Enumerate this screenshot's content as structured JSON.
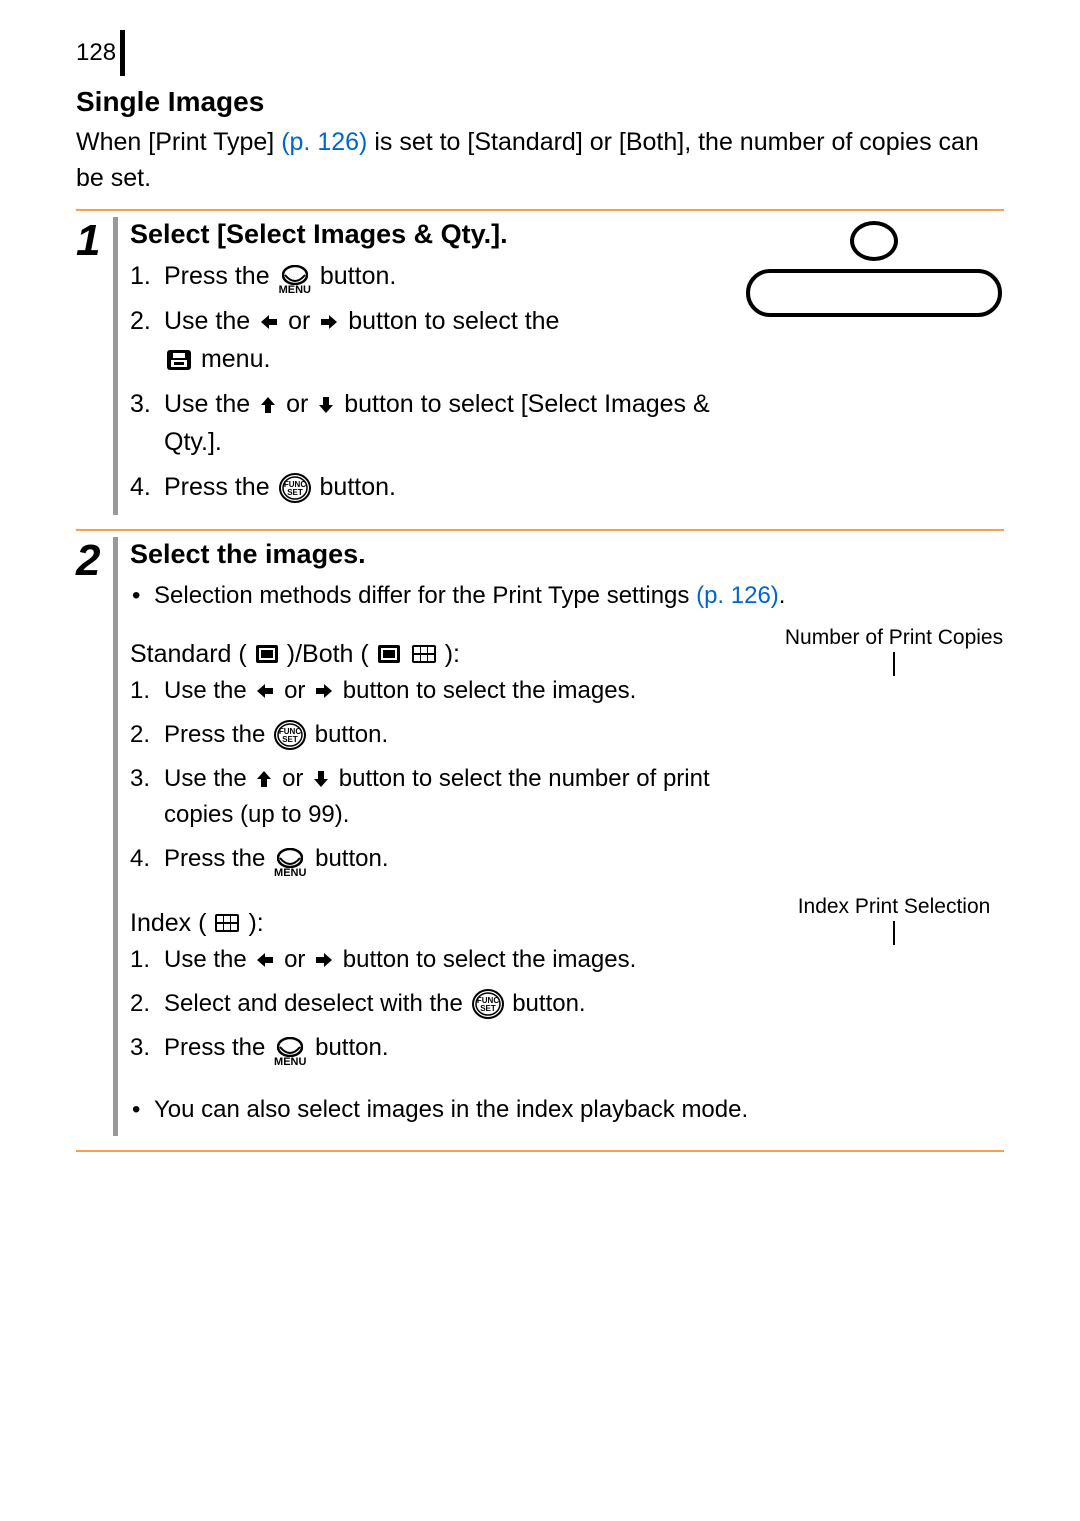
{
  "page_number": "128",
  "section_title": "Single Images",
  "intro_before_link": "When [Print Type] ",
  "intro_link": "(p. 126)",
  "intro_after_link": " is set to [Standard] or [Both], the number of copies can be set.",
  "step1": {
    "num": "1",
    "title": "Select [Select Images & Qty.].",
    "li1_a": "Press the ",
    "li1_b": " button.",
    "menu_sub": "MENU",
    "li2_a": "Use the ",
    "li2_b": " or ",
    "li2_c": " button to select the ",
    "li2_d": " menu.",
    "li3_a": "Use the ",
    "li3_b": " or ",
    "li3_c": " button to select [Select Images & Qty.].",
    "li4_a": "Press the ",
    "li4_b": " button."
  },
  "step2": {
    "num": "2",
    "title": "Select the images.",
    "bullet1_a": "Selection methods differ for the Print Type settings ",
    "bullet1_link": "(p. 126)",
    "bullet1_b": ".",
    "std_heading_a": "Standard (",
    "std_heading_b": ")/Both (",
    "std_heading_c": "):",
    "side_copies": "Number of Print Copies",
    "std_li1_a": "Use the ",
    "std_li1_b": " or ",
    "std_li1_c": " button to select the images.",
    "std_li2_a": "Press the ",
    "std_li2_b": " button.",
    "std_li3_a": "Use the ",
    "std_li3_b": " or ",
    "std_li3_c": " button to select the number of print copies (up to 99).",
    "std_li4_a": "Press the ",
    "std_li4_b": " button.",
    "idx_heading_a": "Index (",
    "idx_heading_b": "):",
    "side_index": "Index Print Selection",
    "idx_li1_a": "Use the ",
    "idx_li1_b": " or ",
    "idx_li1_c": " button to select the images.",
    "idx_li2_a": "Select and deselect with the ",
    "idx_li2_b": " button.",
    "idx_li3_a": "Press the ",
    "idx_li3_b": " button.",
    "bullet2": "You can also select images in the index playback mode."
  }
}
